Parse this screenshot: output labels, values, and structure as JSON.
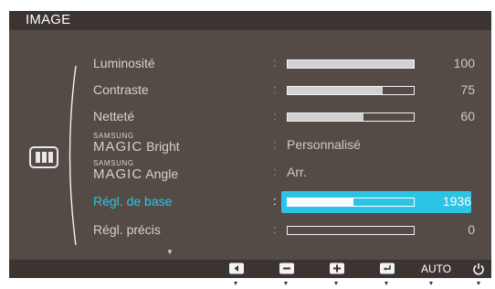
{
  "header": {
    "title": "IMAGE"
  },
  "menu": {
    "items": [
      {
        "label": "Luminosité",
        "type": "bar",
        "value": 100,
        "percent": 100,
        "value_text": "100"
      },
      {
        "label": "Contraste",
        "type": "bar",
        "value": 75,
        "percent": 75,
        "value_text": "75"
      },
      {
        "label": "Netteté",
        "type": "bar",
        "value": 60,
        "percent": 60,
        "value_text": "60"
      },
      {
        "brand_small": "SAMSUNG",
        "brand_big": "MAGIC",
        "label": "Bright",
        "type": "text",
        "value_text": "Personnalisé"
      },
      {
        "brand_small": "SAMSUNG",
        "brand_big": "MAGIC",
        "label": "Angle",
        "type": "text",
        "value_text": "Arr."
      },
      {
        "label": "Régl. de base",
        "type": "bar",
        "value": 1936,
        "percent": 52,
        "value_text": "1936",
        "selected": true
      },
      {
        "label": "Régl. précis",
        "type": "bar",
        "value": 0,
        "percent": 0,
        "value_text": "0"
      }
    ],
    "separator": ":",
    "more_indicator": "▼"
  },
  "footer": {
    "buttons": [
      {
        "icon": "left-arrow-icon",
        "label": ""
      },
      {
        "icon": "minus-icon",
        "label": ""
      },
      {
        "icon": "plus-icon",
        "label": ""
      },
      {
        "icon": "enter-icon",
        "label": ""
      },
      {
        "icon": "",
        "label": "AUTO"
      },
      {
        "icon": "power-icon",
        "label": ""
      }
    ]
  },
  "colors": {
    "panel_bg": "#544b47",
    "bar_bg": "#3b3431",
    "accent": "#2cc4e4",
    "text": "#d6d0cc"
  },
  "icons": {
    "category": "image-icon"
  }
}
